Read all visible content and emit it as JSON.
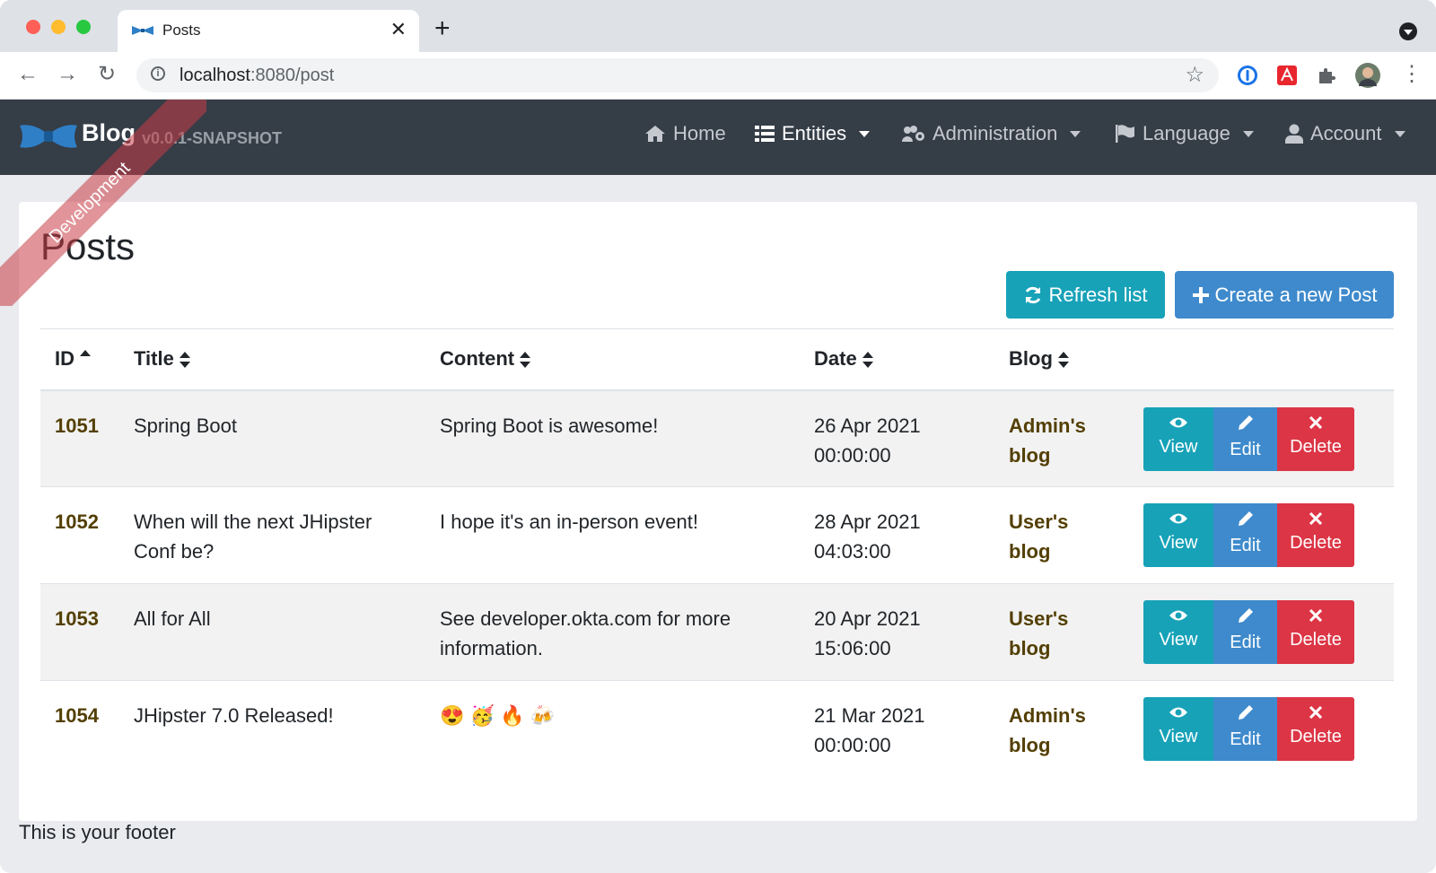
{
  "browser": {
    "tab_title": "Posts",
    "url_host": "localhost",
    "url_rest": ":8080/post"
  },
  "navbar": {
    "brand_name": "Blog",
    "brand_version": "v0.0.1-SNAPSHOT",
    "ribbon_text": "Development",
    "items": [
      {
        "label": "Home",
        "icon": "home-icon"
      },
      {
        "label": "Entities",
        "icon": "list-icon",
        "active": true
      },
      {
        "label": "Administration",
        "icon": "users-cog-icon"
      },
      {
        "label": "Language",
        "icon": "flag-icon"
      },
      {
        "label": "Account",
        "icon": "user-icon"
      }
    ]
  },
  "page": {
    "title": "Posts",
    "refresh_label": "Refresh list",
    "create_label": "Create a new Post"
  },
  "table": {
    "headers": [
      "ID",
      "Title",
      "Content",
      "Date",
      "Blog"
    ],
    "rows": [
      {
        "id": "1051",
        "title": "Spring Boot",
        "content": "Spring Boot is awesome!",
        "date_line1": "26 Apr 2021",
        "date_line2": "00:00:00",
        "blog_line1": "Admin's",
        "blog_line2": "blog"
      },
      {
        "id": "1052",
        "title": "When will the next JHipster Conf be?",
        "content": "I hope it's an in-person event!",
        "date_line1": "28 Apr 2021",
        "date_line2": "04:03:00",
        "blog_line1": "User's",
        "blog_line2": "blog"
      },
      {
        "id": "1053",
        "title": "All for All",
        "content": "See developer.okta.com for more information.",
        "date_line1": "20 Apr 2021",
        "date_line2": "15:06:00",
        "blog_line1": "User's",
        "blog_line2": "blog"
      },
      {
        "id": "1054",
        "title": "JHipster 7.0 Released!",
        "content": "😍 🥳 🔥 🍻",
        "date_line1": "21 Mar 2021",
        "date_line2": "00:00:00",
        "blog_line1": "Admin's",
        "blog_line2": "blog"
      }
    ],
    "actions": {
      "view": "View",
      "edit": "Edit",
      "delete": "Delete"
    }
  },
  "footer": {
    "text": "This is your footer"
  },
  "colors": {
    "navbar_bg": "#353d47",
    "info": "#17a2b8",
    "primary": "#3e8acc",
    "danger": "#dc3545",
    "link": "#533f03"
  }
}
